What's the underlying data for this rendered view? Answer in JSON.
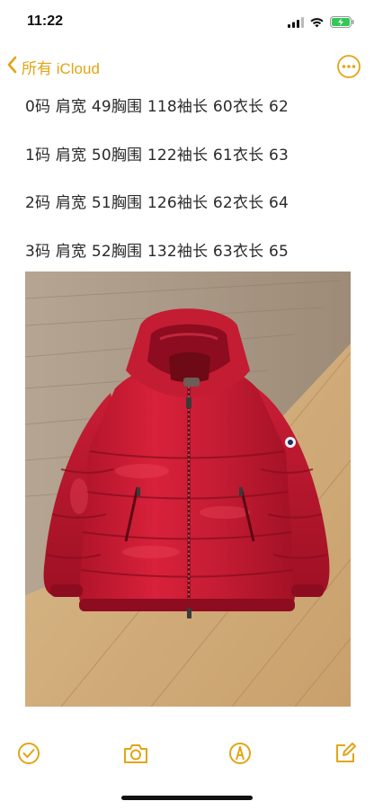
{
  "status_bar": {
    "time": "11:22",
    "icons": [
      "cellular-signal-icon",
      "wifi-icon",
      "battery-charging-icon"
    ],
    "battery_color": "#34c759"
  },
  "nav": {
    "back_label": "所有 iCloud",
    "back_icon": "chevron-left-icon",
    "more_icon": "more-options-icon",
    "accent_color": "#e2a514"
  },
  "note": {
    "lines": [
      "0码 肩宽 49胸围 118袖长 60衣长 62",
      "1码 肩宽 50胸围 122袖长 61衣长 63",
      "2码 肩宽 51胸围 126袖长 62衣长 64",
      "3码 肩宽 52胸围 132袖长 63衣长 65"
    ],
    "image": "photo-red-down-jacket"
  },
  "toolbar": {
    "items": [
      "checklist-icon",
      "camera-icon",
      "markup-pen-icon",
      "compose-icon"
    ]
  }
}
